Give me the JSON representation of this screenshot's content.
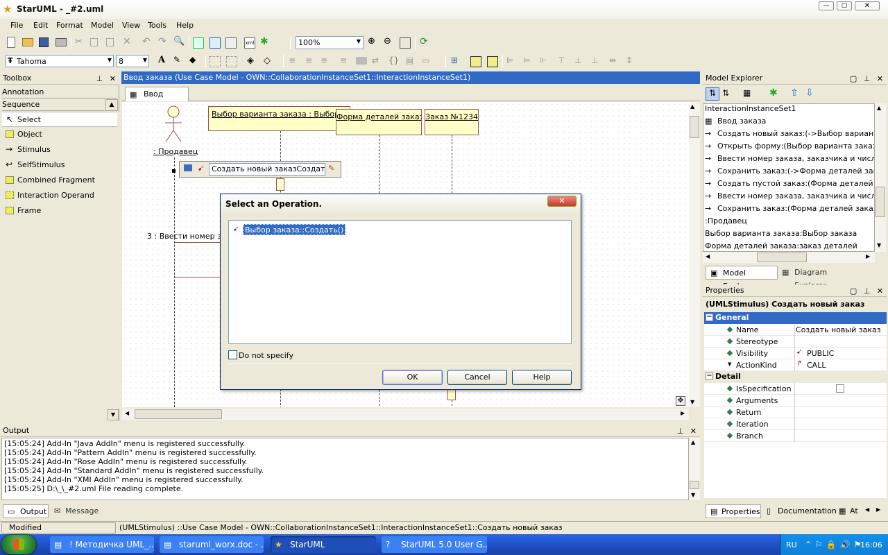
{
  "window": {
    "title": "StarUML - _#2.uml"
  },
  "menu": [
    "File",
    "Edit",
    "Format",
    "Model",
    "View",
    "Tools",
    "Help"
  ],
  "toolbar": {
    "zoom": "100%",
    "font_name": "Tahoma",
    "font_size": "8"
  },
  "toolbox": {
    "title": "Toolbox",
    "groups": [
      "Annotation",
      "Sequence"
    ],
    "items": [
      "Select",
      "Object",
      "Stimulus",
      "SelfStimulus",
      "Combined Fragment",
      "Interaction Operand",
      "Frame"
    ]
  },
  "diagram": {
    "header": "Ввод заказа (Use Case Model - OWN::CollaborationInstanceSet1::InteractionInstanceSet1)",
    "tab": "Ввод заказа",
    "actor": ": Продавец",
    "objects": [
      "Выбор варианта заказа : Выбор заказа",
      "Форма деталей заказа",
      "Заказ №1234"
    ],
    "inline_edit": "Создать новый заказСоздать",
    "message3": "3 : Ввести номер заказа"
  },
  "dialog": {
    "title": "Select an Operation.",
    "operation": "Выбор заказа::Создать()",
    "checkbox": "Do not specify",
    "ok": "OK",
    "cancel": "Cancel",
    "help": "Help"
  },
  "model_explorer": {
    "title": "Model Explorer",
    "rows": [
      "InteractionInstanceSet1",
      "Ввод заказа",
      "Создать новый заказ:(->Выбор варианта заказа)",
      "Открыть форму:(Выбор варианта заказа->Форма деталей заказа)",
      "Ввести номер заказа, заказчика и число заказов",
      "Сохранить заказ:(->Форма деталей заказа)",
      "Создать пустой заказ:(Форма деталей заказа)",
      "Ввести номер заказа, заказчика и число заказов",
      "Сохранить заказ:(Форма деталей заказа->Заказ)",
      ":Продавец",
      "Выбор варианта заказа:Выбор заказа",
      "Форма деталей заказа:заказ деталей"
    ],
    "tabs": [
      "Model Explorer",
      "Diagram Explorer"
    ]
  },
  "properties": {
    "title": "Properties",
    "header": "(UMLStimulus) Создать новый заказ",
    "general_label": "General",
    "general": [
      {
        "name": "Name",
        "value": "Создать новый заказ"
      },
      {
        "name": "Stereotype",
        "value": ""
      },
      {
        "name": "Visibility",
        "value": "PUBLIC"
      },
      {
        "name": "ActionKind",
        "value": "CALL"
      }
    ],
    "detail_label": "Detail",
    "detail": [
      {
        "name": "IsSpecification",
        "value": ""
      },
      {
        "name": "Arguments",
        "value": ""
      },
      {
        "name": "Return",
        "value": ""
      },
      {
        "name": "Iteration",
        "value": ""
      },
      {
        "name": "Branch",
        "value": ""
      }
    ],
    "tabs": [
      "Properties",
      "Documentation",
      "At"
    ]
  },
  "output": {
    "title": "Output",
    "lines": [
      "[15:05:24]  Add-In \"Java AddIn\" menu is registered successfully.",
      "[15:05:24]  Add-In \"Pattern AddIn\" menu is registered successfully.",
      "[15:05:24]  Add-In \"Rose AddIn\" menu is registered successfully.",
      "[15:05:24]  Add-In \"Standard AddIn\" menu is registered successfully.",
      "[15:05:24]  Add-In \"XMI AddIn\" menu is registered successfully.",
      "[15:05:25]  D:\\_\\_#2.uml File reading complete."
    ],
    "tabs": [
      "Output",
      "Message"
    ]
  },
  "status": {
    "left": "Modified",
    "path": "(UMLStimulus) ::Use Case Model - OWN::CollaborationInstanceSet1::InteractionInstanceSet1::Создать новый заказ"
  },
  "taskbar": {
    "items": [
      "! Методичка UML_...",
      "staruml_worx.doc - ...",
      "StarUML",
      "StarUML 5.0 User G..."
    ],
    "lang": "RU",
    "clock": "16:06"
  },
  "colors": {
    "title_bar": "#0a246a",
    "selection": "#316ac5",
    "taskbar": "#245edb",
    "object_fill": "#ffffc8"
  }
}
